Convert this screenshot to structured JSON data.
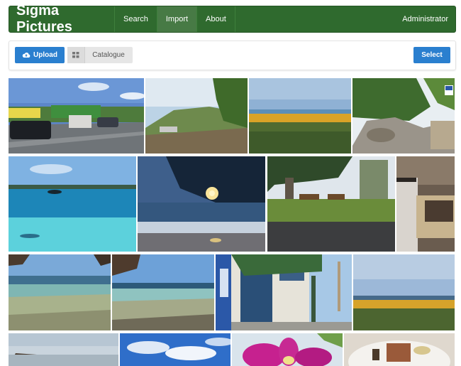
{
  "navbar": {
    "brand": "Sigma Pictures",
    "items": [
      {
        "label": "Search"
      },
      {
        "label": "Import",
        "active": true
      },
      {
        "label": "About"
      }
    ],
    "user": "Administrator"
  },
  "toolbar": {
    "upload_label": "Upload",
    "upload_icon": "cloud-upload-icon",
    "catalogue_label": "Catalogue",
    "catalogue_icon": "grid-icon",
    "select_label": "Select"
  },
  "colors": {
    "navbar": "#2f6a2e",
    "primary_button": "#2a7fcf"
  },
  "gallery": {
    "photos": [
      {
        "subject": "street-with-cars"
      },
      {
        "subject": "coastal-hillside"
      },
      {
        "subject": "heathland-flowers"
      },
      {
        "subject": "rocky-path"
      },
      {
        "subject": "turquoise-bay"
      },
      {
        "subject": "beach-sunset"
      },
      {
        "subject": "park-benches"
      },
      {
        "subject": "interior-room"
      },
      {
        "subject": "clear-shallow-water"
      },
      {
        "subject": "rocky-shore-water"
      },
      {
        "subject": "shop-front"
      },
      {
        "subject": "coastal-dusk"
      },
      {
        "subject": "cloudy-beach"
      },
      {
        "subject": "blue-sky-clouds"
      },
      {
        "subject": "pink-orchid"
      },
      {
        "subject": "plated-food"
      }
    ]
  }
}
